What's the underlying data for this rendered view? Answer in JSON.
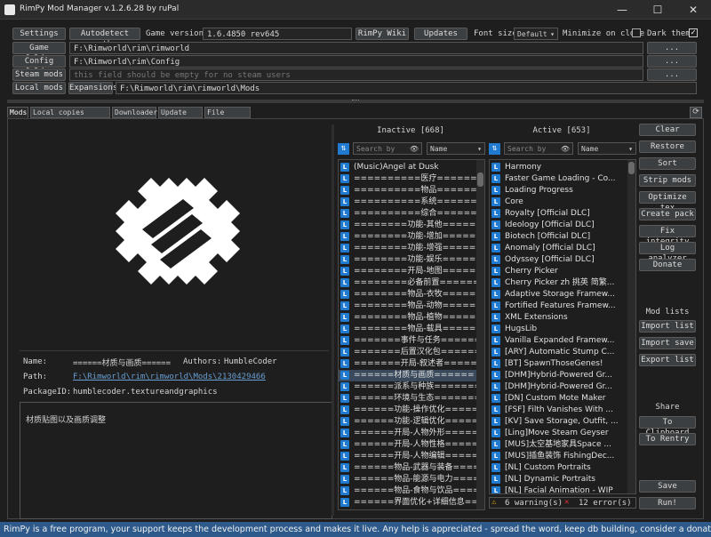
{
  "window": {
    "title": "RimPy Mod Manager v.1.2.6.28 by ruPal",
    "minimize": "—",
    "maximize": "☐",
    "close": "✕"
  },
  "toolbar": {
    "settings": "Settings",
    "autodetect": "Autodetect paths",
    "game_version_label": "Game version:",
    "game_version": "1.6.4850 rev645",
    "rimpy_wiki": "RimPy Wiki",
    "updates": "Updates",
    "font_size_label": "Font size",
    "font_size_value": "Default",
    "minimize_on_close": "Minimize on close",
    "dark_theme": "Dark theme",
    "game_folder_btn": "Game folder",
    "game_folder": "F:\\Rimworld\\rim\\rimworld",
    "config_folder_btn": "Config folder",
    "config_folder": "F:\\Rimworld\\rim\\Config",
    "steam_mods_btn": "Steam mods",
    "steam_mods_placeholder": "this field should be empty for no steam users",
    "local_mods_btn": "Local mods",
    "expansions_btn": "Expansions",
    "local_mods": "F:\\Rimworld\\rim\\rimworld\\Mods",
    "browse": "..."
  },
  "tabs": [
    "Mods",
    "Local copies (WIP)",
    "Downloader",
    "Update log",
    "File Search"
  ],
  "details": {
    "name_label": "Name:",
    "name": "======材质与画质======",
    "authors_label": "Authors:",
    "authors": "HumbleCoder",
    "path_label": "Path:",
    "path": "F:\\Rimworld\\rim\\rimworld\\Mods\\2130429466",
    "package_label": "PackageID:",
    "package": "humblecoder.textureandgraphics",
    "description": "材质贴图以及画质调整"
  },
  "inactive": {
    "header": "Inactive [668]",
    "search_placeholder": "Search by",
    "sort": "Name",
    "items": [
      "(Music)Angel at Dusk",
      "==========医疗=========",
      "==========物品=========",
      "==========系统=========",
      "==========综合=========",
      "========功能-其他=======",
      "========功能-增加=======",
      "========功能-增强=======",
      "========功能-娱乐=======",
      "========开局-地图=======",
      "========必备前置=======",
      "========物品-衣牧=======",
      "========物品-动物=======",
      "========物品-植物=======",
      "========物品-载具=======",
      "=======事件与任务=======",
      "=======后置汉化包=======",
      "=======开局-叙述者=======",
      "======材质与画质======",
      "======派系与种族=======",
      "======环境与生态=======",
      "======功能-操作优化======",
      "======功能-逻辑优化======",
      "======开局-人物外形======",
      "======开局-人物性格======",
      "======开局-人物编辑======",
      "======物品-武器与装备====",
      "======物品-能源与电力====",
      "======物品-食物与饮品====",
      "======界面优化+详细信息===="
    ],
    "selected_index": 18
  },
  "active": {
    "header": "Active [653]",
    "search_placeholder": "Search by",
    "sort": "Name",
    "items": [
      "Harmony",
      "Faster Game Loading - Co...",
      "Loading Progress",
      "Core",
      "Royalty [Official DLC]",
      "Ideology [Official DLC]",
      "Biotech [Official DLC]",
      "Anomaly [Official DLC]",
      "Odyssey [Official DLC]",
      "Cherry Picker",
      "Cherry Picker zh 挑英 简繁...",
      "Adaptive Storage Framew...",
      "Fortified Features Framew...",
      "XML Extensions",
      "HugsLib",
      "Vanilla Expanded Framew...",
      "[ARY] Automatic Stump C...",
      "[BT] SpawnThoseGenes!",
      "[DHM]Hybrid-Powered Gr...",
      "[DHM]Hybrid-Powered Gr...",
      "[DN] Custom Mote Maker",
      "[FSF] Filth Vanishes With ...",
      "[KV] Save Storage, Outfit, ...",
      "[Ling]Move Steam Geyser",
      "[MUS]太空基地家具Space ...",
      "[MUS]插鱼装饰 FishingDec...",
      "[NL] Custom Portraits",
      "[NL] Dynamic Portraits",
      "[NL] Facial Animation - WIP"
    ],
    "warnings": "6 warning(s)",
    "errors": "12 error(s)"
  },
  "actions": {
    "clear": "Clear",
    "restore": "Restore",
    "sort": "Sort",
    "strip_mods": "Strip mods",
    "optimize_tex": "Optimize tex",
    "create_pack": "Create pack",
    "fix_integrity": "Fix integrity",
    "log_analyzer": "Log analyzer",
    "donate": "Donate",
    "mod_lists_label": "Mod lists",
    "import_list": "Import list",
    "import_save": "Import save",
    "export_list": "Export list",
    "share_label": "Share",
    "to_clipboard": "To Clipboard",
    "to_rentry": "To Rentry",
    "save": "Save",
    "run": "Run!"
  },
  "footer": "RimPy is a free program, your support keeps the development process and makes it live. Any help is appreciated - spread the word, keep db building, consider a donation (you may hide this"
}
